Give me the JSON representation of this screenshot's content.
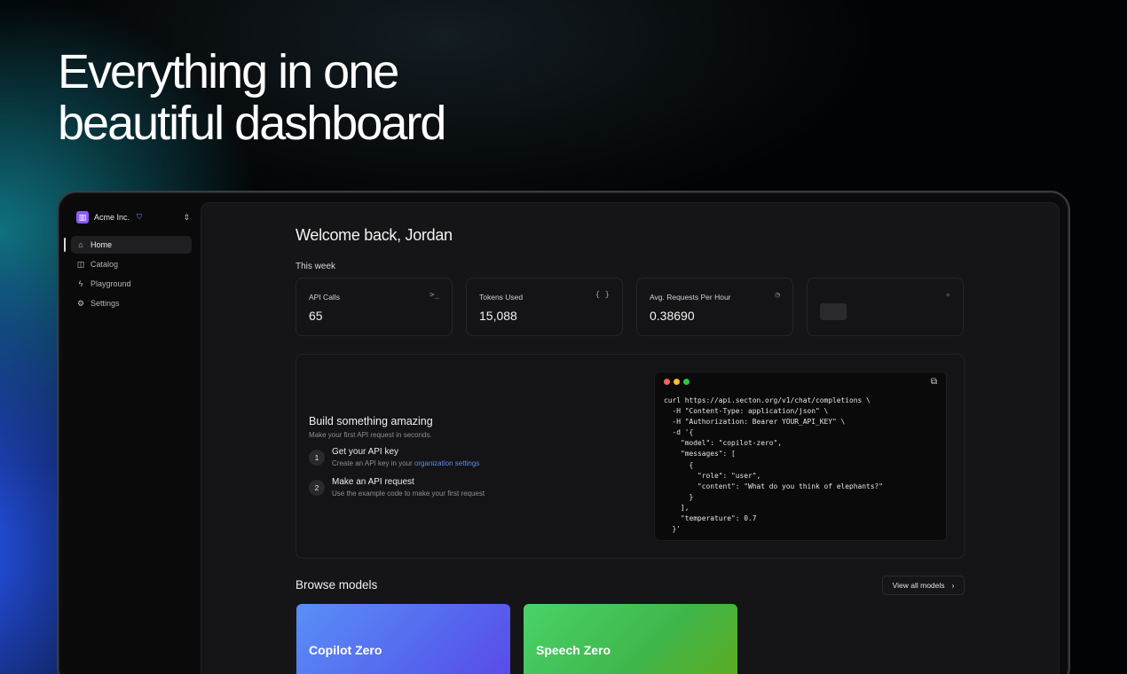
{
  "hero": {
    "line1": "Everything in one",
    "line2": "beautiful dashboard"
  },
  "sidebar": {
    "org_name": "Acme Inc.",
    "items": [
      {
        "label": "Home",
        "icon": "home-icon",
        "active": true
      },
      {
        "label": "Catalog",
        "icon": "book-icon",
        "active": false
      },
      {
        "label": "Playground",
        "icon": "lightning-icon",
        "active": false
      },
      {
        "label": "Settings",
        "icon": "gear-icon",
        "active": false
      }
    ]
  },
  "main": {
    "welcome": "Welcome back, Jordan",
    "week_label": "This week",
    "stats": [
      {
        "label": "API Calls",
        "value": "65",
        "icon": "terminal-icon"
      },
      {
        "label": "Tokens Used",
        "value": "15,088",
        "icon": "braces-icon"
      },
      {
        "label": "Avg. Requests Per Hour",
        "value": "0.38690",
        "icon": "clock-icon"
      },
      {
        "label": "",
        "value": "",
        "icon": "sparkle-icon"
      }
    ],
    "build": {
      "title": "Build something amazing",
      "subtitle": "Make your first API request in seconds.",
      "steps": [
        {
          "num": "1",
          "title": "Get your API key",
          "desc": "Create an API key in your ",
          "link": "organization settings"
        },
        {
          "num": "2",
          "title": "Make an API request",
          "desc": "Use the example code to make your first request"
        }
      ],
      "code": "curl https://api.secton.org/v1/chat/completions \\\n  -H \"Content-Type: application/json\" \\\n  -H \"Authorization: Bearer YOUR_API_KEY\" \\\n  -d '{\n    \"model\": \"copilot-zero\",\n    \"messages\": [\n      {\n        \"role\": \"user\",\n        \"content\": \"What do you think of elephants?\"\n      }\n    ],\n    \"temperature\": 0.7\n  }'"
    },
    "browse": {
      "title": "Browse models",
      "view_all": "View all models",
      "models": [
        {
          "name": "Copilot Zero"
        },
        {
          "name": "Speech Zero"
        }
      ]
    }
  },
  "colors": {
    "accent_link": "#5b8def",
    "org_logo": "#8b5cf6",
    "dot_red": "#ff5f57",
    "dot_yellow": "#febc2e",
    "dot_green": "#28c840"
  }
}
